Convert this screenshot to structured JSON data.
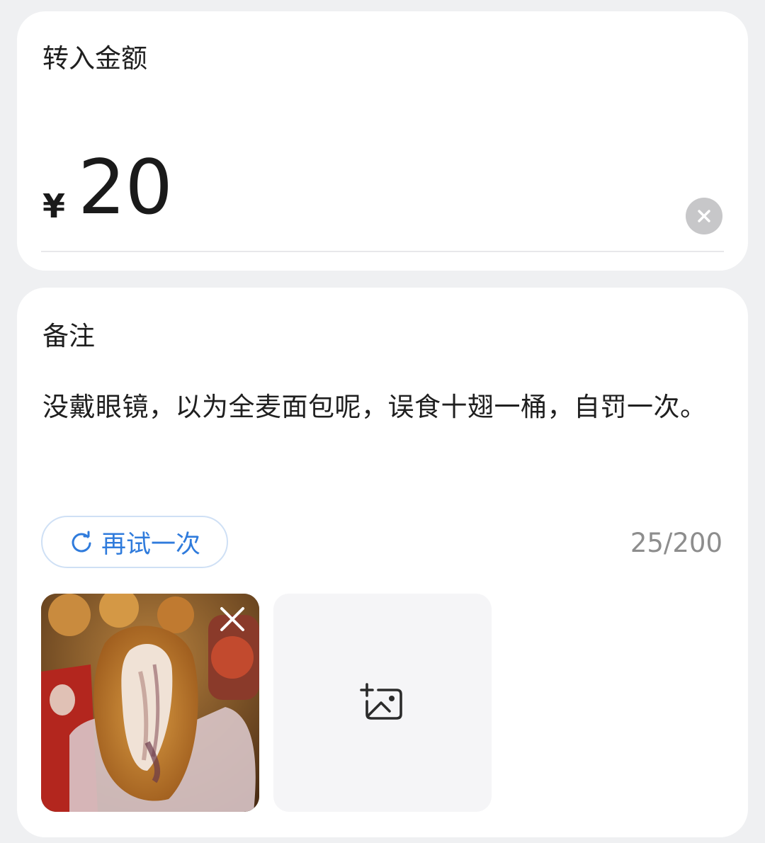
{
  "amount": {
    "label": "转入金额",
    "currency": "¥",
    "value": "20"
  },
  "remark": {
    "label": "备注",
    "text": "没戴眼镜，以为全麦面包呢，误食十翅一桶，自罚一次。",
    "retry_label": "再试一次",
    "counter": "25/200"
  },
  "icons": {
    "clear": "clear-circle-icon",
    "refresh": "refresh-icon",
    "remove": "close-icon",
    "add_image": "add-image-icon"
  },
  "colors": {
    "accent": "#2f7bdc",
    "background": "#eff0f2",
    "card": "#ffffff"
  }
}
